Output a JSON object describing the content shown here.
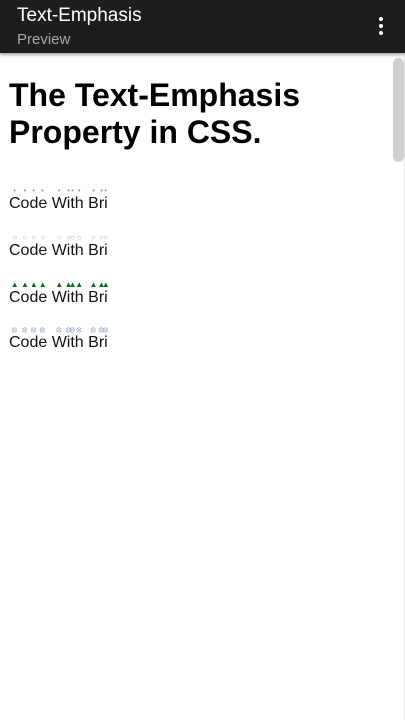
{
  "appbar": {
    "title": "Text-Emphasis",
    "subtitle": "Preview",
    "menu_icon": "more-vert-icon"
  },
  "page": {
    "heading": "The Text-Emphasis Property in CSS.",
    "examples": [
      {
        "text": "Code With Bri",
        "emphasis": "dot",
        "color": "#a0a0a0"
      },
      {
        "text": "Code With Bri",
        "emphasis": "open circle",
        "color": "#b0b0b0"
      },
      {
        "text": "Code With Bri",
        "emphasis": "triangle",
        "color": "#0e6b17"
      },
      {
        "text": "Code With Bri",
        "emphasis": "custom symbol",
        "color": "#7a8fc0"
      }
    ]
  },
  "colors": {
    "appbar_bg": "#1c1e1d",
    "appbar_title": "#ffffff",
    "appbar_subtitle": "#a7a9a8"
  }
}
